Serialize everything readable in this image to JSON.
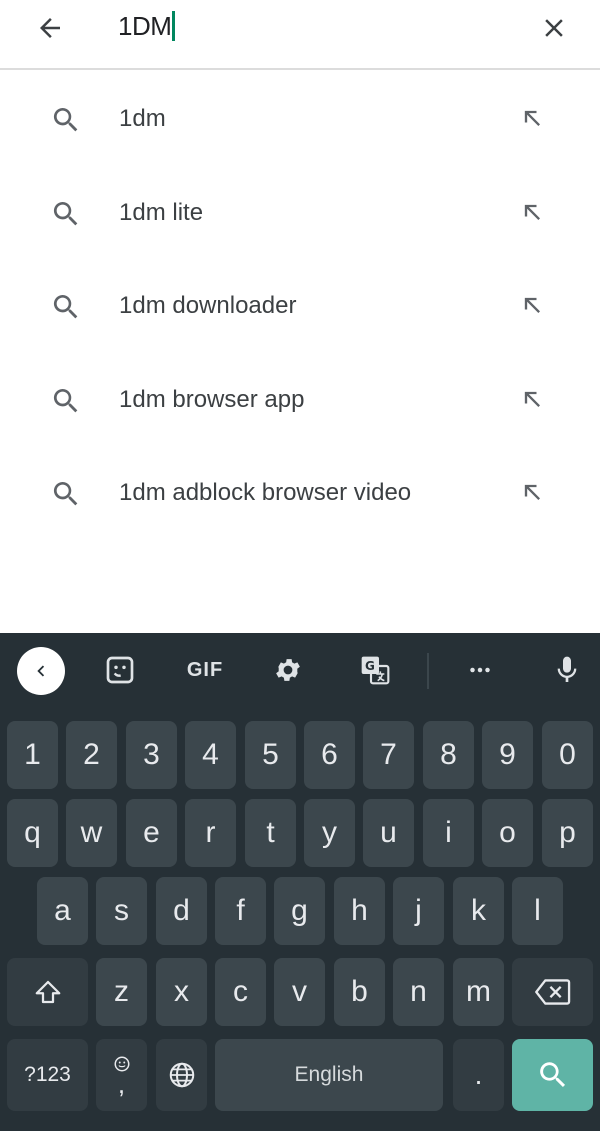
{
  "search": {
    "query": "1DM"
  },
  "suggestions": [
    {
      "text": "1dm"
    },
    {
      "text": "1dm lite"
    },
    {
      "text": "1dm downloader"
    },
    {
      "text": "1dm browser app"
    },
    {
      "text": "1dm adblock browser video"
    }
  ],
  "keyboard": {
    "toolbar": {
      "gif_label": "GIF"
    },
    "row_numbers": [
      "1",
      "2",
      "3",
      "4",
      "5",
      "6",
      "7",
      "8",
      "9",
      "0"
    ],
    "row_q": [
      "q",
      "w",
      "e",
      "r",
      "t",
      "y",
      "u",
      "i",
      "o",
      "p"
    ],
    "row_a": [
      "a",
      "s",
      "d",
      "f",
      "g",
      "h",
      "j",
      "k",
      "l"
    ],
    "row_z": [
      "z",
      "x",
      "c",
      "v",
      "b",
      "n",
      "m"
    ],
    "symbols_label": "?123",
    "comma_label": ",",
    "space_label": "English",
    "period_label": ".",
    "colors": {
      "background": "#263036",
      "key": "#3c474d",
      "action_key": "#5fb4a6",
      "caret": "#01875f"
    }
  }
}
